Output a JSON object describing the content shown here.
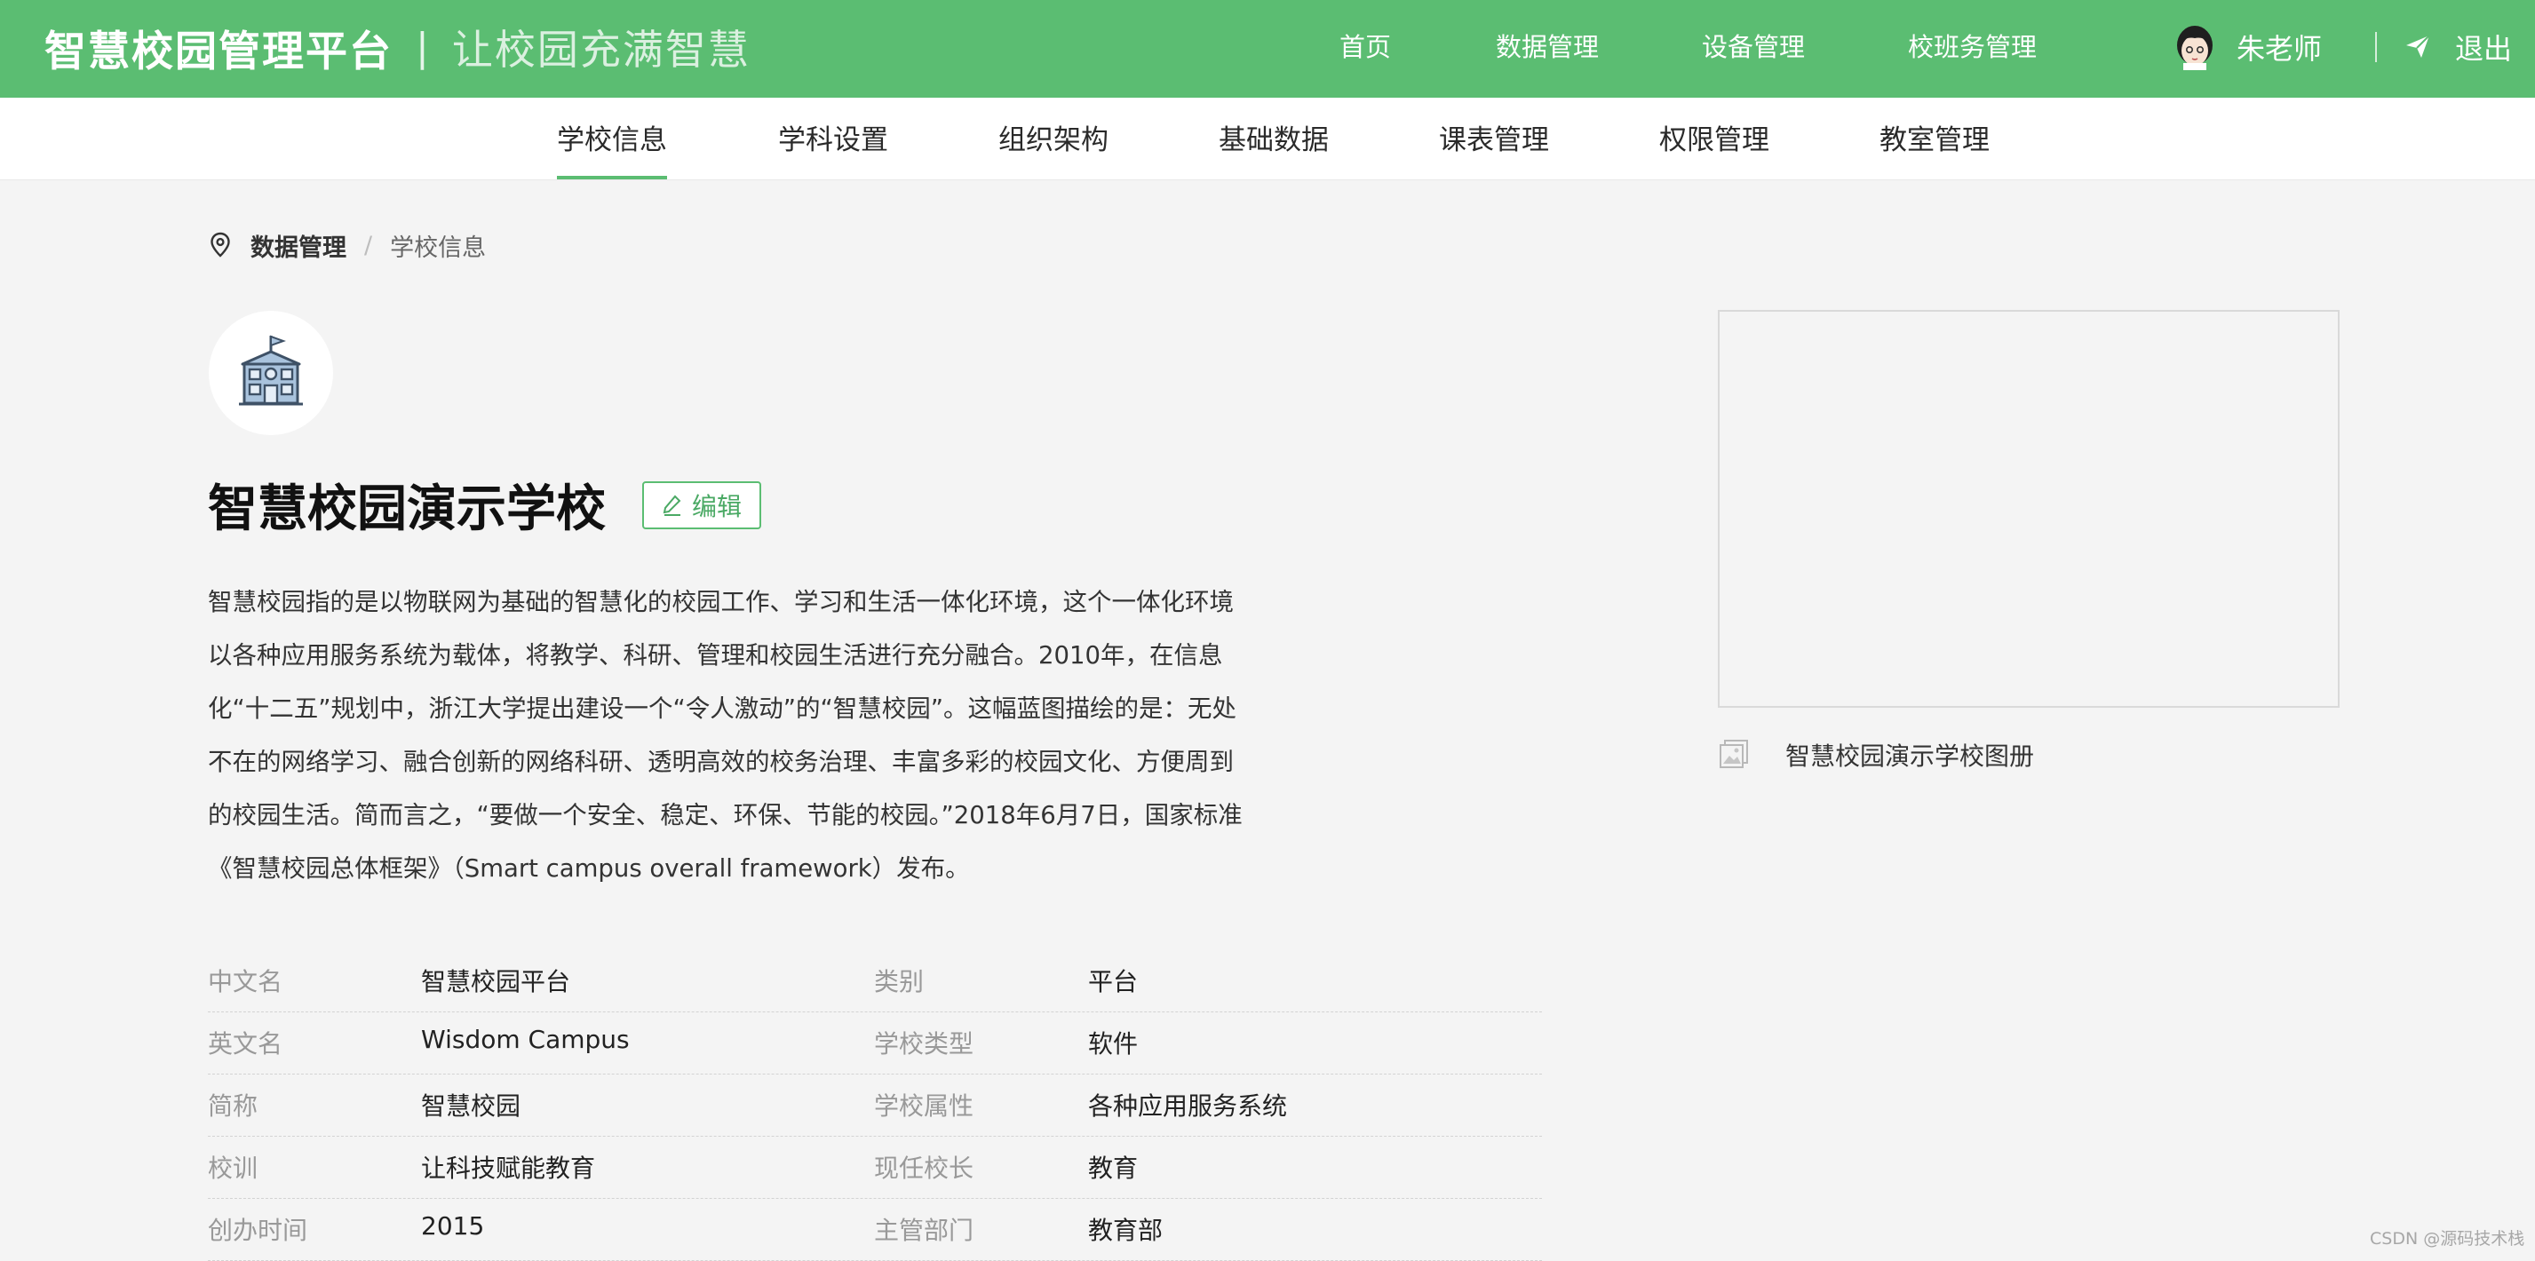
{
  "header": {
    "platform_title": "智慧校园管理平台",
    "separator": "|",
    "slogan": "让校园充满智慧",
    "nav": [
      "首页",
      "数据管理",
      "设备管理",
      "校班务管理"
    ],
    "user_name": "朱老师",
    "logout_label": "退出"
  },
  "subnav": {
    "items": [
      "学校信息",
      "学科设置",
      "组织架构",
      "基础数据",
      "课表管理",
      "权限管理",
      "教室管理"
    ],
    "active": "学校信息"
  },
  "breadcrumb": {
    "root": "数据管理",
    "separator": "/",
    "current": "学校信息"
  },
  "school": {
    "name": "智慧校园演示学校",
    "edit_label": "编辑",
    "description_lines": [
      "智慧校园指的是以物联网为基础的智慧化的校园工作、学习和生活一体化环境，这个一体化环境",
      "以各种应用服务系统为载体，将教学、科研、管理和校园生活进行充分融合。2010年，在信息",
      "化“十二五”规划中，浙江大学提出建设一个“令人激动”的“智慧校园”。这幅蓝图描绘的是：无处",
      "不在的网络学习、融合创新的网络科研、透明高效的校务治理、丰富多彩的校园文化、方便周到",
      "的校园生活。简而言之，“要做一个安全、稳定、环保、节能的校园。”2018年6月7日，国家标准",
      "《智慧校园总体框架》（Smart campus overall framework）发布。"
    ]
  },
  "info": [
    {
      "k1": "中文名",
      "v1": "智慧校园平台",
      "k2": "类别",
      "v2": "平台"
    },
    {
      "k1": "英文名",
      "v1": "Wisdom Campus",
      "k2": "学校类型",
      "v2": "软件"
    },
    {
      "k1": "简称",
      "v1": "智慧校园",
      "k2": "学校属性",
      "v2": "各种应用服务系统"
    },
    {
      "k1": "校训",
      "v1": "让科技赋能教育",
      "k2": "现任校长",
      "v2": "教育"
    },
    {
      "k1": "创办时间",
      "v1": "2015",
      "k2": "主管部门",
      "v2": "教育部"
    }
  ],
  "album": {
    "label": "智慧校园演示学校图册"
  },
  "watermark": "CSDN @源码技术栈",
  "colors": {
    "brand_green": "#5bbd72",
    "page_bg": "#f4f4f4"
  },
  "icons": [
    "avatar",
    "send-icon",
    "location-pin-icon",
    "school-building-icon",
    "edit-pencil-icon",
    "image-album-icon"
  ]
}
